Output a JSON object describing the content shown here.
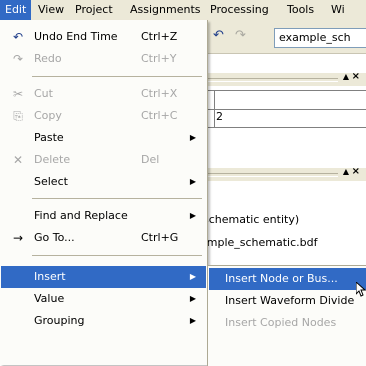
{
  "menubar": {
    "items": [
      {
        "label": "Edit"
      },
      {
        "label": "View"
      },
      {
        "label": "Project"
      },
      {
        "label": "Assignments"
      },
      {
        "label": "Processing"
      },
      {
        "label": "Tools"
      },
      {
        "label": "Wi"
      }
    ]
  },
  "toolbar": {
    "undo_icon": "undo-icon",
    "redo_icon": "redo-icon",
    "combo_value": "example_sch"
  },
  "background": {
    "grid_value": "2",
    "line1": "'schematic entity)",
    "line2": "ample_schematic.bdf"
  },
  "edit_menu": {
    "items": [
      {
        "icon": "↶",
        "icon_name": "undo-icon",
        "label": "Undo End Time",
        "shortcut": "Ctrl+Z",
        "enabled": true
      },
      {
        "icon": "↷",
        "icon_name": "redo-icon",
        "label": "Redo",
        "shortcut": "Ctrl+Y",
        "enabled": false
      },
      {
        "icon": "✂",
        "icon_name": "scissors-icon",
        "label": "Cut",
        "shortcut": "Ctrl+X",
        "enabled": false
      },
      {
        "icon": "⎘",
        "icon_name": "copy-icon",
        "label": "Copy",
        "shortcut": "Ctrl+C",
        "enabled": false
      },
      {
        "icon": "",
        "icon_name": "",
        "label": "Paste",
        "shortcut": "",
        "enabled": true
      },
      {
        "icon": "✕",
        "icon_name": "delete-icon",
        "label": "Delete",
        "shortcut": "Del",
        "enabled": false
      },
      {
        "icon": "",
        "icon_name": "",
        "label": "Select",
        "shortcut": "",
        "enabled": true
      },
      {
        "icon": "",
        "icon_name": "",
        "label": "Find and Replace",
        "shortcut": "",
        "enabled": true
      },
      {
        "icon": "→",
        "icon_name": "go-to-arrow-icon",
        "label": "Go To...",
        "shortcut": "Ctrl+G",
        "enabled": true
      },
      {
        "icon": "",
        "icon_name": "",
        "label": "Insert",
        "shortcut": "",
        "enabled": true
      },
      {
        "icon": "",
        "icon_name": "",
        "label": "Value",
        "shortcut": "",
        "enabled": true
      },
      {
        "icon": "",
        "icon_name": "",
        "label": "Grouping",
        "shortcut": "",
        "enabled": true
      }
    ]
  },
  "insert_submenu": {
    "items": [
      {
        "label": "Insert Node or Bus...",
        "enabled": true
      },
      {
        "label": "Insert Waveform Divide",
        "enabled": true
      },
      {
        "label": "Insert Copied Nodes",
        "enabled": false
      }
    ]
  }
}
